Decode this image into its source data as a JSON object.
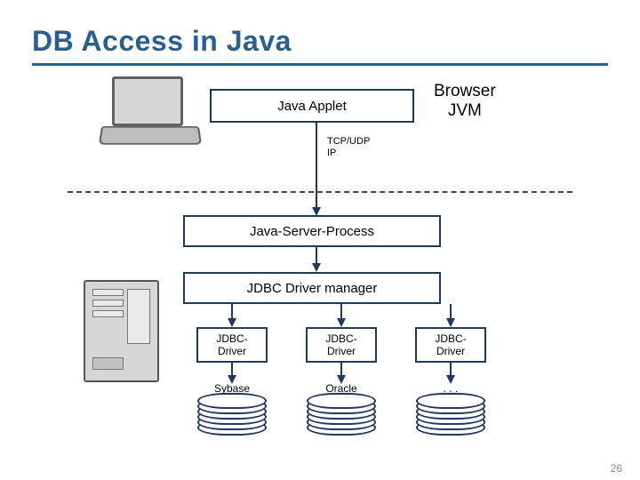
{
  "title": "DB Access in Java",
  "page_number": "26",
  "client": {
    "applet_box": "Java Applet",
    "browser_label_line1": "Browser",
    "browser_label_line2": "JVM"
  },
  "network": {
    "proto_line1": "TCP/UDP",
    "proto_line2": "IP"
  },
  "server": {
    "process_box": "Java-Server-Process",
    "driver_manager_box": "JDBC Driver manager",
    "drivers": [
      {
        "label_line1": "JDBC-",
        "label_line2": "Driver",
        "db_label": "Sybase"
      },
      {
        "label_line1": "JDBC-",
        "label_line2": "Driver",
        "db_label": "Oracle"
      },
      {
        "label_line1": "JDBC-",
        "label_line2": "Driver",
        "db_label": ". . ."
      }
    ]
  }
}
